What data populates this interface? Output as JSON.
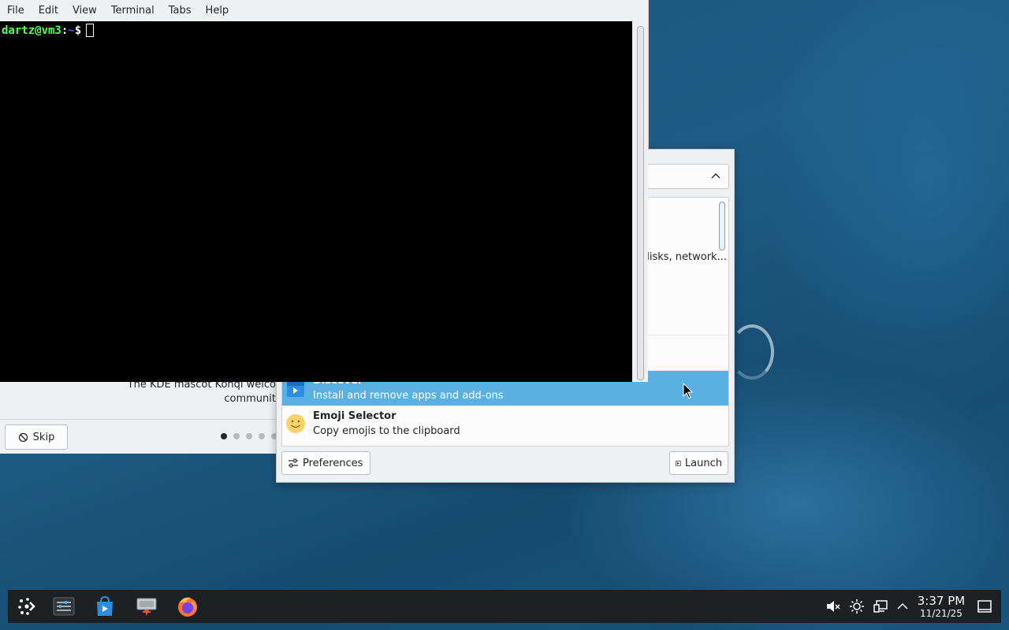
{
  "konsole": {
    "menu": [
      "File",
      "Edit",
      "View",
      "Terminal",
      "Tabs",
      "Help"
    ],
    "prompt_user": "dartz@vm3",
    "prompt_sep": ":",
    "prompt_path": "~",
    "prompt_symbol": "$"
  },
  "welcome": {
    "caption_line1": "The KDE mascot Konqi welco",
    "caption_line2": "communit",
    "skip_label": "Skip",
    "pages_total": 5,
    "current_page": 1
  },
  "launcher": {
    "partial_row_text": "disks, network...",
    "items": [
      {
        "title": "Discover",
        "subtitle": "Install and remove apps and add-ons",
        "icon": "discover-icon",
        "selected": true
      },
      {
        "title": "Emoji Selector",
        "subtitle": "Copy emojis to the clipboard",
        "icon": "emoji-icon",
        "selected": false
      }
    ],
    "preferences_label": "Preferences",
    "launch_label": "Launch"
  },
  "taskbar": {
    "apps": [
      "kde-launcher-icon",
      "konsole-icon",
      "discover-icon",
      "welcome-icon",
      "firefox-icon"
    ],
    "tray": [
      "volume-muted-icon",
      "brightness-icon",
      "network-icon",
      "tray-expand-icon"
    ],
    "clock_time": "3:37 PM",
    "clock_date": "11/21/25",
    "show_desktop": "show-desktop-icon"
  },
  "colors": {
    "selection": "#5ab0e2",
    "terminal_bg": "#000000",
    "prompt_user": "#55ff55",
    "prompt_path": "#5555ff",
    "panel_bg": "#1e2124"
  }
}
